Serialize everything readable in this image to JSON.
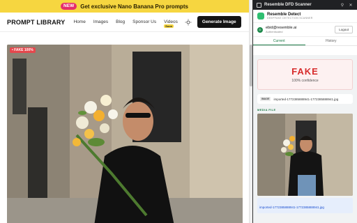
{
  "banner": {
    "badge": "NEW",
    "text": "Get exclusive Nano Banana Pro prompts"
  },
  "nav": {
    "logo": "PROMPT LIBRARY",
    "links": [
      "Home",
      "Images",
      "Blog",
      "Sponsor Us",
      "Videos"
    ],
    "soon_badge": "Soon",
    "generate_label": "Generate Image"
  },
  "image": {
    "badge": "• FAKE 100%"
  },
  "extension": {
    "window_title": "Resemble DFD Scanner",
    "brand_name": "Resemble Detect",
    "brand_sub": "DEEPFAKE DETECTION SCANNER",
    "email": "ebid@resemble.ai",
    "auth_status": "Authenticated",
    "avatar_letter": "D",
    "logout_label": "Logout",
    "tabs": [
      "Current",
      "History"
    ],
    "verdict": "FAKE",
    "confidence": "100% confidence",
    "type_badge": "IMAGE",
    "filename": "imported-1772385888941-1772385888941.jpg",
    "media_label": "MEDIA FILE",
    "link_text": "imported-1772385888941-1772385888941.jpg"
  },
  "colors": {
    "accent": "#1a7a45",
    "fake": "#d72c2c",
    "banner": "#f6d640"
  }
}
